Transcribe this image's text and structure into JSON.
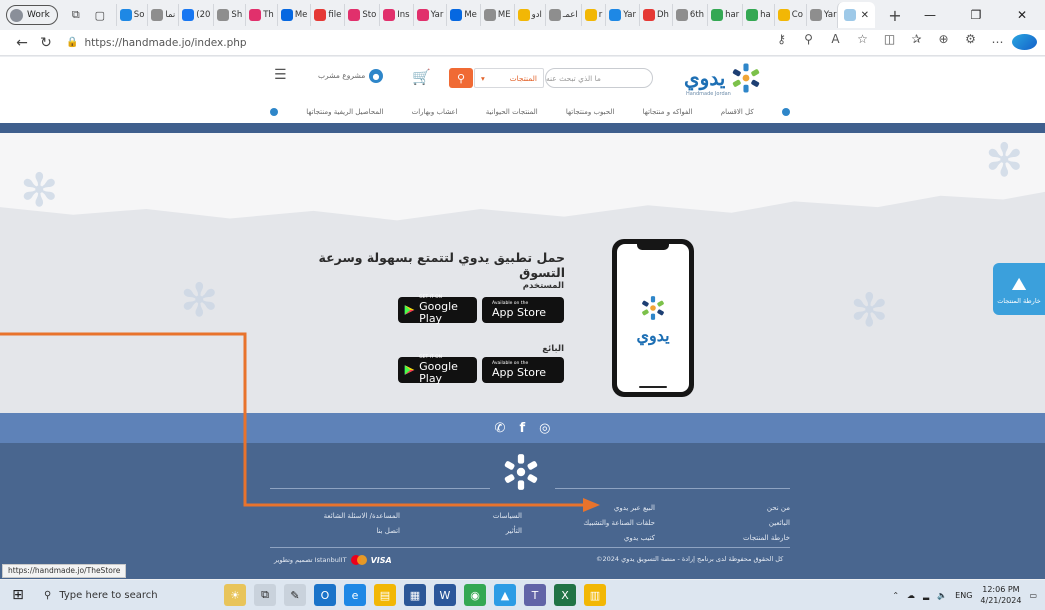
{
  "browser": {
    "profile_label": "Work",
    "tabs": [
      {
        "label": "So",
        "color": "#1e88e5"
      },
      {
        "label": "نما",
        "color": "#8e8e8e"
      },
      {
        "label": "(20",
        "color": "#1877f2"
      },
      {
        "label": "Sh",
        "color": "#8e8e8e"
      },
      {
        "label": "Th",
        "color": "#e1306c"
      },
      {
        "label": "Me",
        "color": "#0668e1"
      },
      {
        "label": "file",
        "color": "#e53935"
      },
      {
        "label": "Sto",
        "color": "#e1306c"
      },
      {
        "label": "Ins",
        "color": "#e1306c"
      },
      {
        "label": "Yar",
        "color": "#e1306c"
      },
      {
        "label": "Me",
        "color": "#0668e1"
      },
      {
        "label": "ME",
        "color": "#8e8e8e"
      },
      {
        "label": "ادو",
        "color": "#f2b705"
      },
      {
        "label": "اعمـ",
        "color": "#8e8e8e"
      },
      {
        "label": "r",
        "color": "#f2b705"
      },
      {
        "label": "Yar",
        "color": "#1e88e5"
      },
      {
        "label": "Dh",
        "color": "#e53935"
      },
      {
        "label": "6th",
        "color": "#8e8e8e"
      },
      {
        "label": "har",
        "color": "#34a853"
      },
      {
        "label": "ha",
        "color": "#34a853"
      },
      {
        "label": "Co",
        "color": "#f2b705"
      },
      {
        "label": "Yar",
        "color": "#8e8e8e"
      }
    ],
    "url": "https://handmade.jo/index.php",
    "status_url": "https://handmade.jo/TheStore"
  },
  "site": {
    "logo_word": "يدوي",
    "logo_tagline": "Handmade Jordan",
    "search_placeholder": "ما الذي تبحث عنه",
    "category_select": "المنتجات",
    "user_label": "مشروع مشرب",
    "nav_items": [
      "كل الاقسام",
      "الفواكه و منتجاتها",
      "الحبوب ومنتجاتها",
      "المنتجات الحيوانية",
      "اعشاب وبهارات",
      "المحاصيل الريفية ومنتجاتها"
    ]
  },
  "promo": {
    "title": "حمل تطبيق يدوي لتتمتع بسهولة وسرعة التسوق",
    "user_section": "المستخدم",
    "seller_section": "البائع",
    "google_small": "GET IT ON",
    "google_big": "Google Play",
    "apple_small": "Available on the",
    "apple_big": "App Store"
  },
  "map_tab": {
    "label": "خارطة المنتجات"
  },
  "footer": {
    "col1": [
      "من نحن",
      "البائعين",
      "خارطة المنتجات"
    ],
    "col2": [
      "البيع عبر يدوي",
      "حلقات الصناعة والتشبيك",
      "كتيب يدوي"
    ],
    "col3": [
      "السياسات",
      "التأثير"
    ],
    "col4": [
      "المساعدة/ الاسئلة الشائعة",
      "اتصل بنا"
    ],
    "copyright": "كل الحقوق محفوظة لدى برنامج إرادة - منصة التسويق يدوي 2024©",
    "credit": "تصميم وتطوير IstanbulIT",
    "visa": "VISA"
  },
  "taskbar": {
    "search_placeholder": "Type here to search",
    "lang": "ENG",
    "time": "12:06 PM",
    "date": "4/21/2024"
  },
  "accent": {
    "orange": "#f06a34",
    "navy": "#49668f",
    "blue": "#5e82b8",
    "arrow": "#e8732c"
  }
}
